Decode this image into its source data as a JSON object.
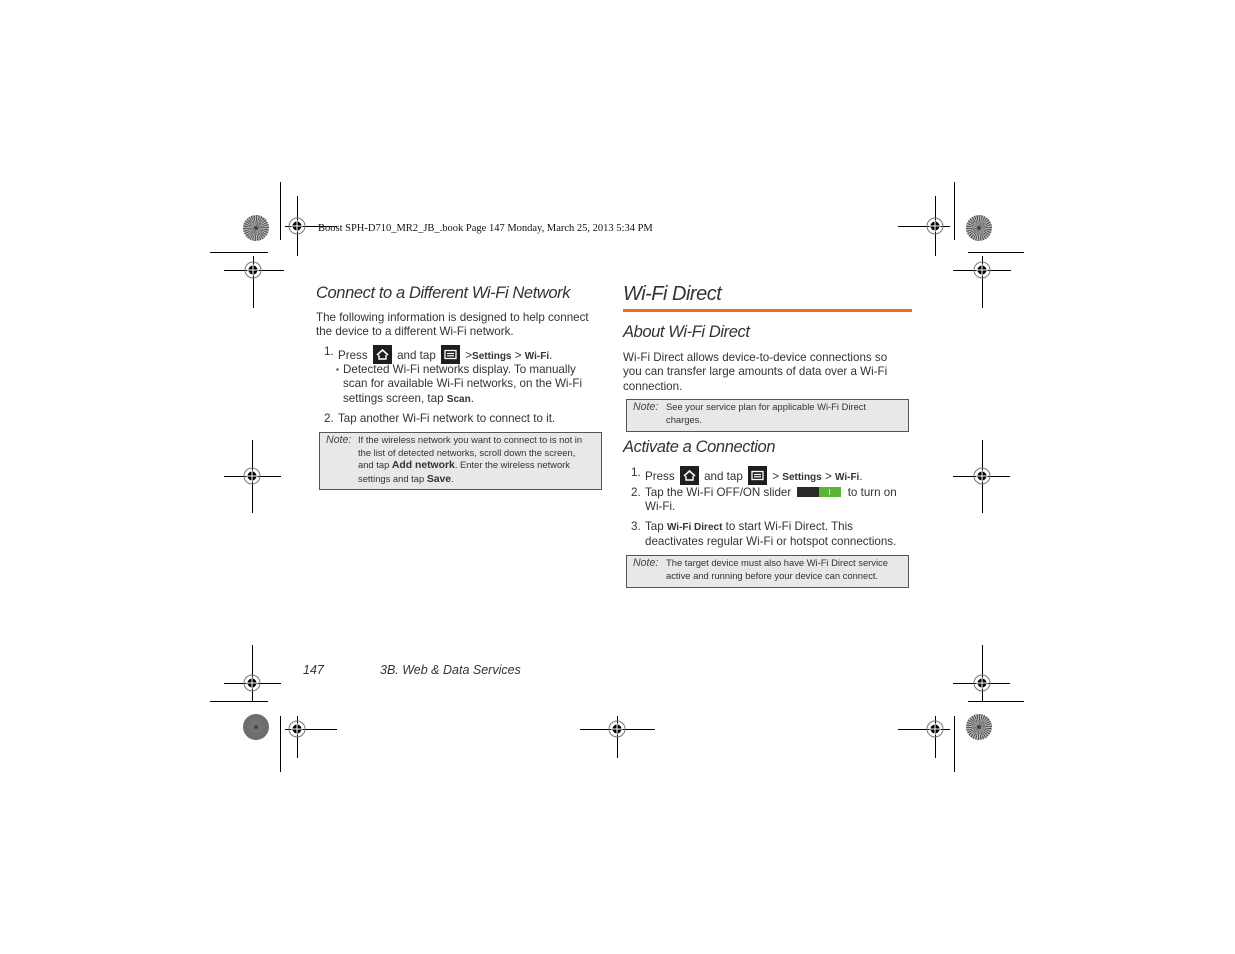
{
  "slug_line": "Boost SPH-D710_MR2_JB_.book  Page 147  Monday, March 25, 2013  5:34 PM",
  "left_column": {
    "heading": "Connect to a Different Wi-Fi Network",
    "intro_line1": "The following information is designed to help connect",
    "intro_line2": "the device to a different Wi-Fi network.",
    "step1": {
      "number": "1.",
      "press": "Press",
      "and_tap": "and tap",
      "sep1": ">",
      "settings": "Settings",
      "sep2": ">",
      "wifi": "Wi-Fi",
      "period": "."
    },
    "bullet": {
      "marker": "▪",
      "line1": "Detected Wi-Fi networks display. To manually",
      "line2": "scan for available Wi-Fi networks, on the Wi-Fi",
      "line3_pre": "settings screen, tap",
      "line3_bold": "Scan",
      "line3_post": "."
    },
    "step2": {
      "number": "2.",
      "text": "Tap another Wi-Fi network to connect to it."
    },
    "note": {
      "label": "Note:",
      "line1": "If the wireless network you want to connect to is not in",
      "line2": "the list of detected networks, scroll down the screen,",
      "line3_pre": "and tap",
      "line3_bold": "Add network",
      "line3_post": ". Enter the wireless network",
      "line4_pre": "settings and tap",
      "line4_bold": "Save",
      "line4_post": "."
    }
  },
  "right_column": {
    "title": "Wi-Fi Direct",
    "accent_color": "#ef6b23",
    "about": {
      "heading": "About Wi-Fi Direct",
      "line1": "Wi-Fi Direct allows device-to-device connections so",
      "line2": "you can transfer large amounts of data over a Wi-Fi",
      "line3": "connection."
    },
    "note1": {
      "label": "Note:",
      "line1": "See your service plan for applicable Wi-Fi Direct",
      "line2": "charges."
    },
    "activate": {
      "heading": "Activate a Connection",
      "step1": {
        "number": "1.",
        "press": "Press",
        "and_tap": "and tap",
        "sep1": ">",
        "settings": "Settings",
        "sep2": ">",
        "wifi": "Wi-Fi",
        "period": "."
      },
      "step2": {
        "number": "2.",
        "pre": "Tap the Wi-Fi OFF/ON slider",
        "post": "to turn on",
        "line2": "Wi-Fi."
      },
      "step3": {
        "number": "3.",
        "pre": "Tap",
        "bold": "Wi-Fi Direct",
        "post": "to start Wi-Fi Direct. This",
        "line2": "deactivates regular Wi-Fi or hotspot connections."
      },
      "slider_colors": {
        "off": "#2a2a2a",
        "on": "#5ab534"
      }
    },
    "note2": {
      "label": "Note:",
      "line1": "The target device must also have Wi-Fi Direct service",
      "line2": "active and running before your device can connect."
    }
  },
  "footer": {
    "page_number": "147",
    "section": "3B. Web & Data Services"
  },
  "icons": {
    "home": "home-icon",
    "menu": "menu-icon",
    "registration": "registration-mark-icon",
    "color_bar": "star-target-icon"
  }
}
